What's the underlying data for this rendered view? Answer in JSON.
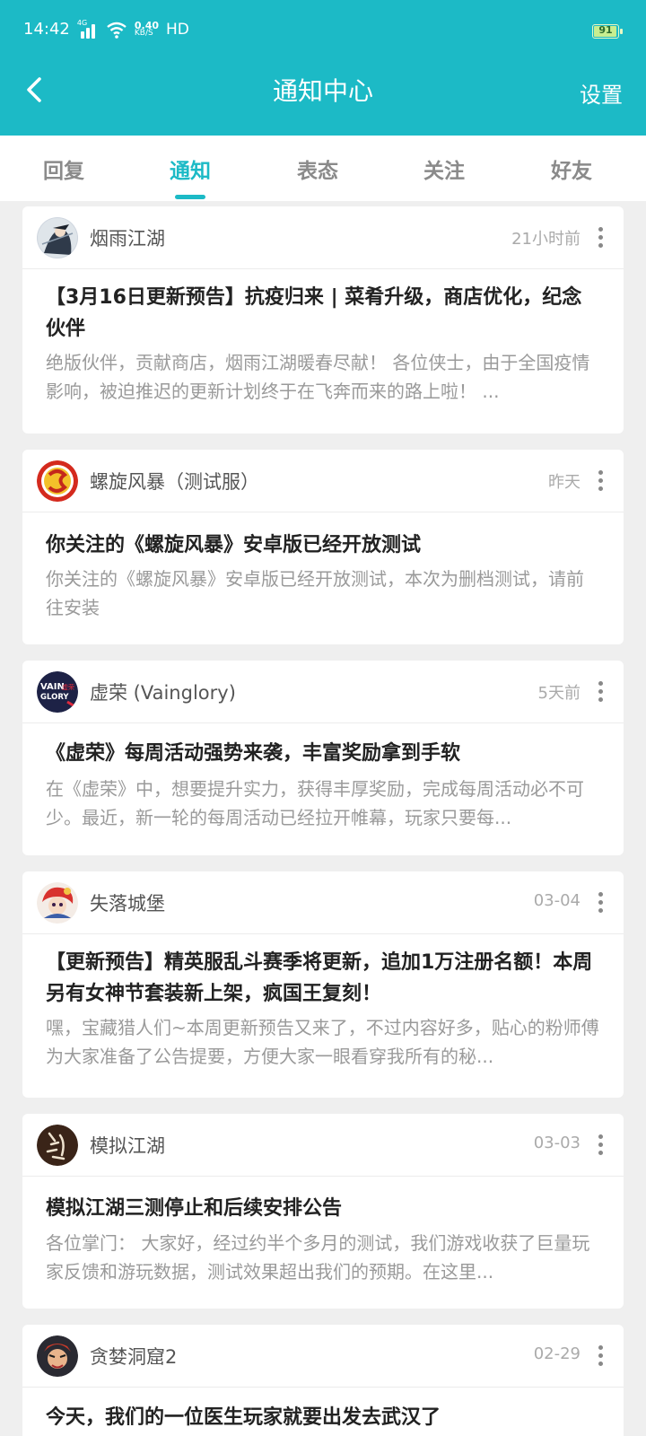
{
  "status": {
    "time": "14:42",
    "network": "4G",
    "speed_value": "0.40",
    "speed_unit": "KB/S",
    "hd": "HD",
    "battery": "91"
  },
  "nav": {
    "title": "通知中心",
    "settings": "设置"
  },
  "tabs": [
    {
      "label": "回复"
    },
    {
      "label": "通知"
    },
    {
      "label": "表态"
    },
    {
      "label": "关注"
    },
    {
      "label": "好友"
    }
  ],
  "active_tab": "通知",
  "colors": {
    "accent": "#1cbac6"
  },
  "notifications": [
    {
      "author": "烟雨江湖",
      "time": "21小时前",
      "title": "【3月16日更新预告】抗疫归来 | 菜肴升级，商店优化，纪念伙伴",
      "summary": "绝版伙伴，贡献商店，烟雨江湖暖春尽献！ 各位侠士，由于全国疫情影响，被迫推迟的更新计划终于在飞奔而来的路上啦！ ..."
    },
    {
      "author": "螺旋风暴（测试服）",
      "time": "昨天",
      "title": "你关注的《螺旋风暴》安卓版已经开放测试",
      "summary": "你关注的《螺旋风暴》安卓版已经开放测试，本次为删档测试，请前往安装"
    },
    {
      "author": "虚荣 (Vainglory)",
      "time": "5天前",
      "title": "《虚荣》每周活动强势来袭，丰富奖励拿到手软",
      "summary": "在《虚荣》中，想要提升实力，获得丰厚奖励，完成每周活动必不可少。最近，新一轮的每周活动已经拉开帷幕，玩家只要每..."
    },
    {
      "author": "失落城堡",
      "time": "03-04",
      "title": "【更新预告】精英服乱斗赛季将更新，追加1万注册名额！本周另有女神节套装新上架，疯国王复刻！",
      "summary": "嘿，宝藏猎人们~本周更新预告又来了，不过内容好多，贴心的粉师傅为大家准备了公告提要，方便大家一眼看穿我所有的秘..."
    },
    {
      "author": "模拟江湖",
      "time": "03-03",
      "title": "模拟江湖三测停止和后续安排公告",
      "summary": "各位掌门： 大家好，经过约半个多月的测试，我们游戏收获了巨量玩家反馈和游玩数据，测试效果超出我们的预期。在这里..."
    },
    {
      "author": "贪婪洞窟2",
      "time": "02-29",
      "title": "今天，我们的一位医生玩家就要出发去武汉了",
      "summary": ""
    }
  ],
  "avatar_labels": {
    "vainglory_top": "VAIN",
    "vainglory_bottom": "GLORY",
    "vainglory_cn": "虚荣"
  }
}
